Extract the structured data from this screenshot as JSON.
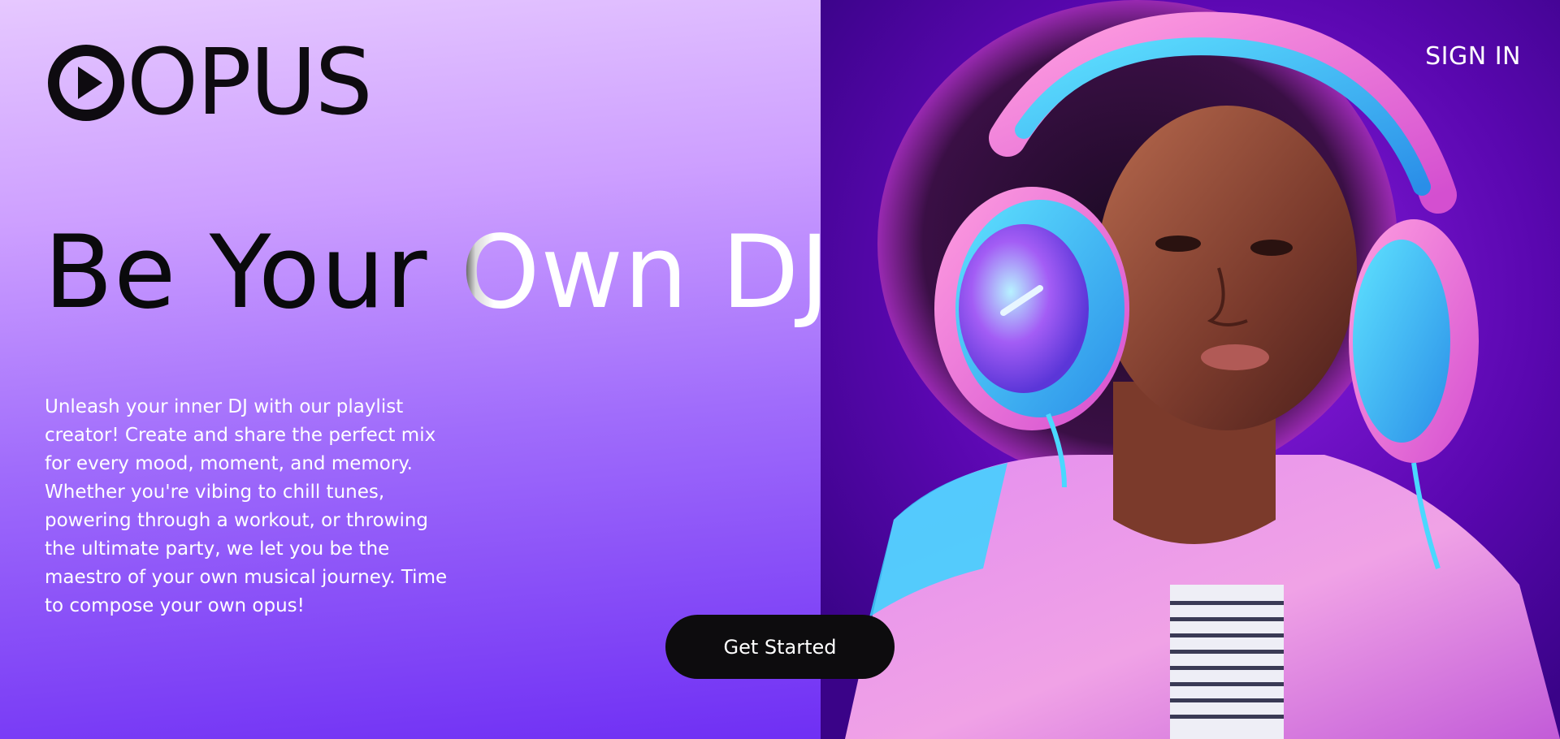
{
  "header": {
    "brand": "OPUS",
    "logo_icon": "play-circle-icon",
    "sign_in_label": "SIGN IN"
  },
  "hero": {
    "headline_dark": "Be Your ",
    "headline_light": "Own DJ",
    "description": "Unleash your inner DJ with our playlist creator! Create and share the perfect mix for every mood, moment, and memory. Whether you're vibing to chill tunes, powering through a workout, or throwing the ultimate party, we let you be the maestro of your own musical journey. Time to compose your own opus!",
    "cta_label": "Get Started"
  },
  "colors": {
    "brand_dark": "#0e0b10",
    "gradient_top": "#e6c8ff",
    "gradient_bottom": "#6f2ff4",
    "photo_background": "#5b08b0",
    "accent_pink": "#f06bd8",
    "accent_cyan": "#38c8f2"
  }
}
